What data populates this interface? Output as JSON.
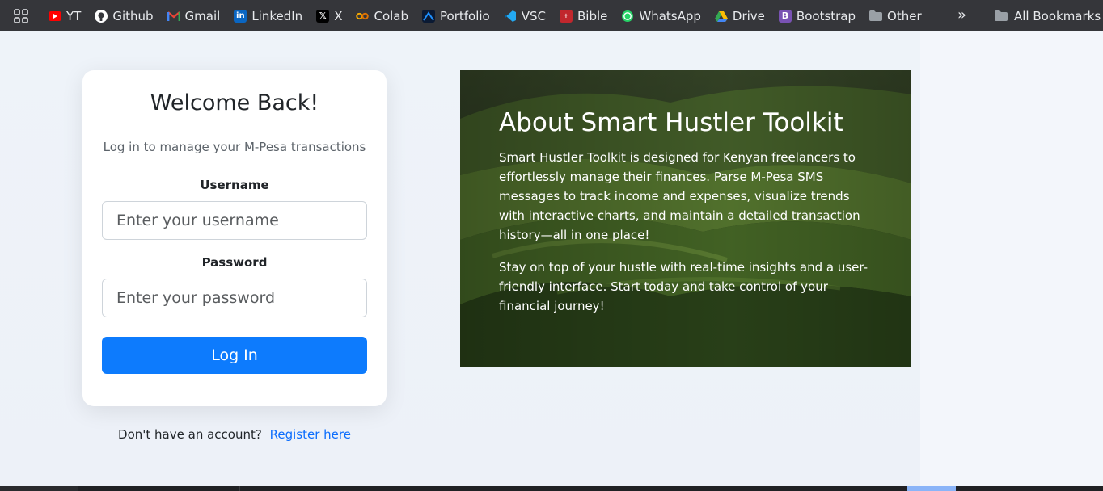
{
  "bookmarks": [
    {
      "label": "YT",
      "icon": "youtube-icon",
      "color": "#ff0000"
    },
    {
      "label": "Github",
      "icon": "github-icon",
      "color": "#ffffff"
    },
    {
      "label": "Gmail",
      "icon": "gmail-icon",
      "color": "#ea4335"
    },
    {
      "label": "LinkedIn",
      "icon": "linkedin-icon",
      "color": "#0a66c2"
    },
    {
      "label": "X",
      "icon": "x-icon",
      "color": "#000000"
    },
    {
      "label": "Colab",
      "icon": "colab-icon",
      "color": "#f9ab00"
    },
    {
      "label": "Portfolio",
      "icon": "portfolio-icon",
      "color": "#1e90ff"
    },
    {
      "label": "VSC",
      "icon": "vscode-icon",
      "color": "#23a9f2"
    },
    {
      "label": "Bible",
      "icon": "bible-icon",
      "color": "#c1272d"
    },
    {
      "label": "WhatsApp",
      "icon": "whatsapp-icon",
      "color": "#25d366"
    },
    {
      "label": "Drive",
      "icon": "drive-icon",
      "color": "#34a853"
    },
    {
      "label": "Bootstrap",
      "icon": "bootstrap-icon",
      "color": "#7952b3"
    },
    {
      "label": "Other",
      "icon": "folder-icon",
      "color": "#9aa0a6"
    }
  ],
  "overflow": "»",
  "all_bookmarks": "All Bookmarks",
  "login": {
    "title": "Welcome Back!",
    "subtitle": "Log in to manage your M-Pesa transactions",
    "username_label": "Username",
    "username_placeholder": "Enter your username",
    "password_label": "Password",
    "password_placeholder": "Enter your password",
    "button": "Log In",
    "register_prompt": "Don't have an account?",
    "register_link": "Register here"
  },
  "about": {
    "title": "About Smart Hustler Toolkit",
    "p1": "Smart Hustler Toolkit is designed for Kenyan freelancers to effortlessly manage their finances. Parse M-Pesa SMS messages to track income and expenses, visualize trends with interactive charts, and maintain a detailed transaction history—all in one place!",
    "p2": "Stay on top of your hustle with real-time insights and a user-friendly interface. Start today and take control of your financial journey!"
  },
  "colors": {
    "primary": "#0d7bfd",
    "link": "#0d6efd",
    "bar_bg": "#35363a"
  }
}
